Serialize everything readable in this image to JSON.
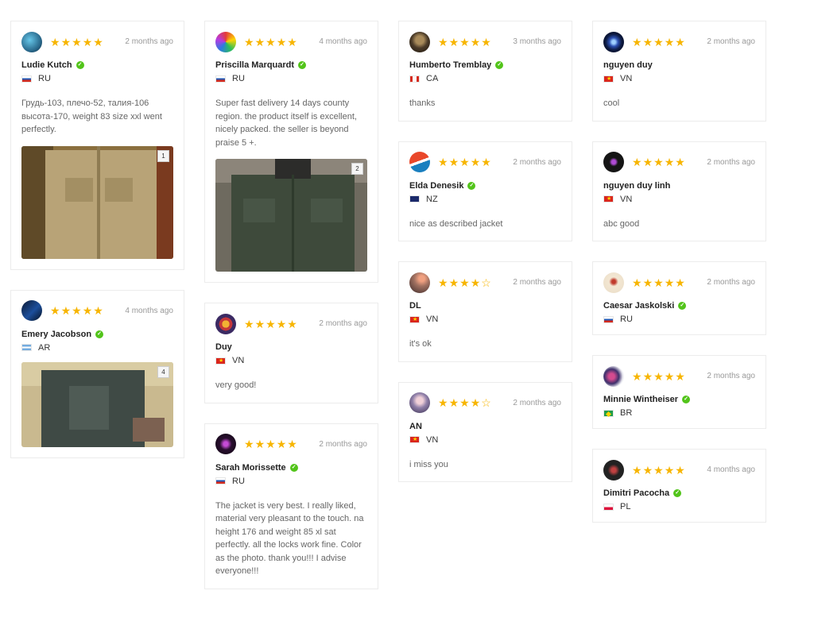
{
  "reviews": [
    {
      "name": "Ludie Kutch",
      "country": "RU",
      "date": "2 months ago",
      "rating": 5,
      "text": "Грудь-103, плечо-52, талия-106 высота-170, weight 83 size xxl went perfectly.",
      "photo_count": "1",
      "avatar_color": "#2b6c8f"
    },
    {
      "name": "Emery Jacobson",
      "country": "AR",
      "date": "4 months ago",
      "rating": 5,
      "text": "",
      "photo_count": "4",
      "avatar_color": "#0d2a55"
    },
    {
      "name": "Priscilla Marquardt",
      "country": "RU",
      "date": "4 months ago",
      "rating": 5,
      "text": "Super fast delivery 14 days county region. the product itself is excellent, nicely packed. the seller is beyond praise 5 +.",
      "photo_count": "2",
      "avatar_color": "#3a2d18"
    },
    {
      "name": "Duy",
      "country": "VN",
      "date": "2 months ago",
      "rating": 5,
      "text": "very good!",
      "avatar_color": "#3b2a63"
    },
    {
      "name": "Sarah Morissette",
      "country": "RU",
      "date": "2 months ago",
      "rating": 5,
      "text": "The jacket is very best. I really liked, material very pleasant to the touch. na height 176 and weight 85 xl sat perfectly. all the locks work fine. Color as the photo. thank you!!! I advise everyone!!!",
      "avatar_color": "#2a0f30"
    },
    {
      "name": "Humberto Tremblay",
      "country": "CA",
      "date": "3 months ago",
      "rating": 5,
      "text": "thanks",
      "avatar_color": "#4a3a28"
    },
    {
      "name": "Elda Denesik",
      "country": "NZ",
      "date": "2 months ago",
      "rating": 5,
      "text": "nice as described jacket",
      "avatar_color": "#d4502b"
    },
    {
      "name": "DL",
      "country": "VN",
      "date": "2 months ago",
      "rating": 4,
      "text": "it's ok",
      "avatar_color": "#7a5a5a"
    },
    {
      "name": "AN",
      "country": "VN",
      "date": "2 months ago",
      "rating": 4,
      "text": "i miss you",
      "avatar_color": "#8f7fa8"
    },
    {
      "name": "nguyen duy",
      "country": "VN",
      "date": "2 months ago",
      "rating": 5,
      "text": "cool",
      "avatar_color": "#1b2a66"
    },
    {
      "name": "nguyen duy linh",
      "country": "VN",
      "date": "2 months ago",
      "rating": 5,
      "text": "abc good",
      "avatar_color": "#151515"
    },
    {
      "name": "Caesar Jaskolski",
      "country": "RU",
      "date": "2 months ago",
      "rating": 5,
      "text": "",
      "avatar_color": "#e9dcc6"
    },
    {
      "name": "Minnie Wintheiser",
      "country": "BR",
      "date": "2 months ago",
      "rating": 5,
      "text": "",
      "avatar_color": "#3d2f6b"
    },
    {
      "name": "Dimitri Pacocha",
      "country": "PL",
      "date": "4 months ago",
      "rating": 5,
      "text": "",
      "avatar_color": "#222222"
    }
  ],
  "colors": {
    "star": "#f7b500",
    "verified": "#52c41a"
  }
}
